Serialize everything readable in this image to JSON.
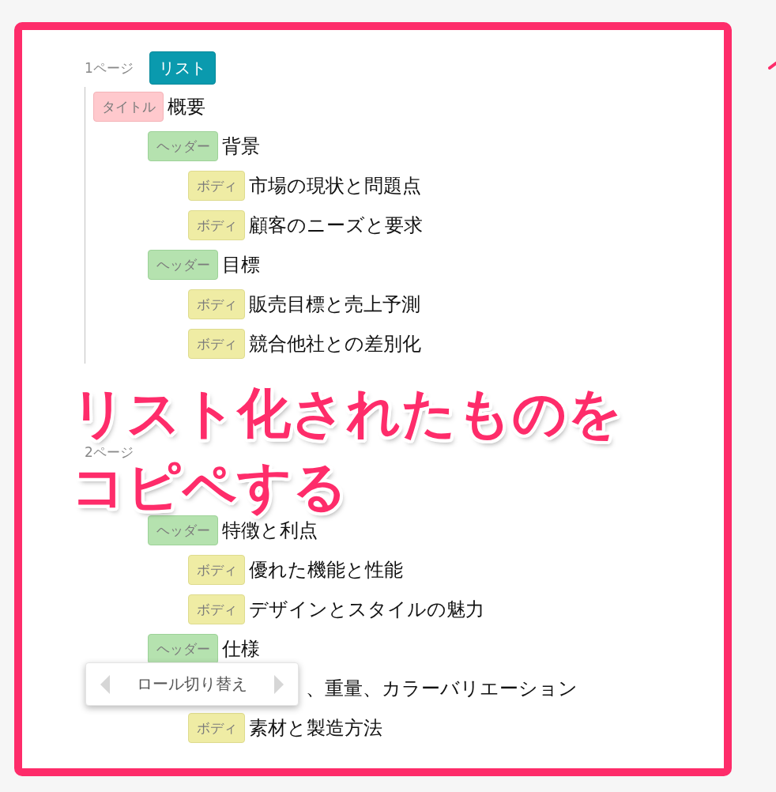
{
  "pages": [
    {
      "label": "1ページ",
      "selected": true,
      "list_button": "リスト",
      "items": [
        {
          "tag": {
            "kind": "title",
            "label": "タイトル"
          },
          "text": "概要",
          "children": [
            {
              "tag": {
                "kind": "header",
                "label": "ヘッダー"
              },
              "text": "背景",
              "children": [
                {
                  "tag": {
                    "kind": "body",
                    "label": "ボディ"
                  },
                  "text": "市場の現状と問題点"
                },
                {
                  "tag": {
                    "kind": "body",
                    "label": "ボディ"
                  },
                  "text": "顧客のニーズと要求"
                }
              ]
            },
            {
              "tag": {
                "kind": "header",
                "label": "ヘッダー"
              },
              "text": "目標",
              "children": [
                {
                  "tag": {
                    "kind": "body",
                    "label": "ボディ"
                  },
                  "text": "販売目標と売上予測"
                },
                {
                  "tag": {
                    "kind": "body",
                    "label": "ボディ"
                  },
                  "text": "競合他社との差別化"
                }
              ]
            }
          ]
        }
      ]
    },
    {
      "label": "2ページ",
      "selected": false,
      "items": [
        {
          "children": [
            {
              "tag": {
                "kind": "header",
                "label": "ヘッダー"
              },
              "text": "特徴と利点",
              "children": [
                {
                  "tag": {
                    "kind": "body",
                    "label": "ボディ"
                  },
                  "text": "優れた機能と性能"
                },
                {
                  "tag": {
                    "kind": "body",
                    "label": "ボディ"
                  },
                  "text": "デザインとスタイルの魅力"
                }
              ]
            },
            {
              "tag": {
                "kind": "header",
                "label": "ヘッダー"
              },
              "text": "仕様",
              "children": [
                {
                  "text": "、重量、カラーバリエーション"
                },
                {
                  "tag": {
                    "kind": "body",
                    "label": "ボディ"
                  },
                  "text": "素材と製造方法"
                }
              ]
            }
          ]
        }
      ]
    }
  ],
  "role_popup": {
    "label": "ロール切り替え"
  },
  "caption": [
    "リスト化されたものを",
    "コピペする"
  ]
}
